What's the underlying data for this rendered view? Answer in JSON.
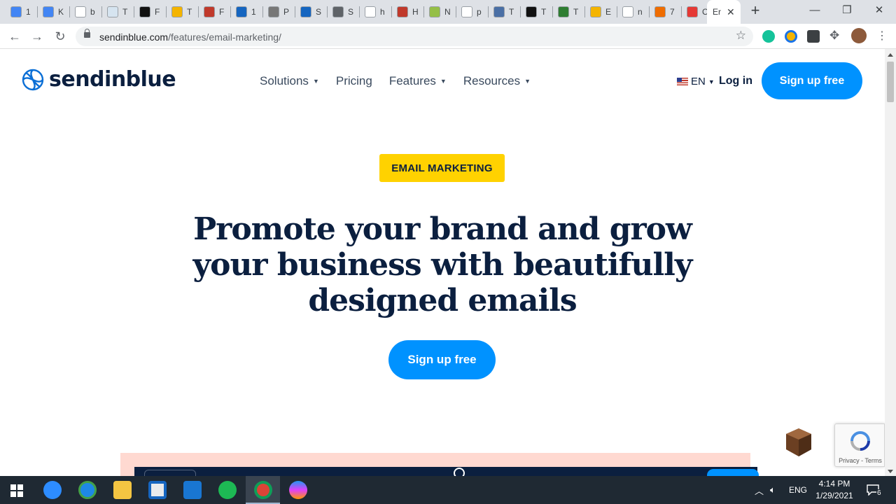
{
  "browser": {
    "tabs": [
      {
        "label": "1",
        "color": "#4285f4"
      },
      {
        "label": "K",
        "color": "#4285f4"
      },
      {
        "label": "b",
        "color": "#ffffff"
      },
      {
        "label": "T",
        "color": "#d6e4f0"
      },
      {
        "label": "F",
        "color": "#111111"
      },
      {
        "label": "T",
        "color": "#f4b400"
      },
      {
        "label": "F",
        "color": "#c0392b"
      },
      {
        "label": "1",
        "color": "#1565c0"
      },
      {
        "label": "P",
        "color": "#777777"
      },
      {
        "label": "S",
        "color": "#1565c0"
      },
      {
        "label": "S",
        "color": "#5f6368"
      },
      {
        "label": "h",
        "color": "#ffffff"
      },
      {
        "label": "H",
        "color": "#c0392b"
      },
      {
        "label": "N",
        "color": "#95bf47"
      },
      {
        "label": "p",
        "color": "#ffffff"
      },
      {
        "label": "T",
        "color": "#4a6fa5"
      },
      {
        "label": "T",
        "color": "#111111"
      },
      {
        "label": "T",
        "color": "#2e7d32"
      },
      {
        "label": "E",
        "color": "#f4b400"
      },
      {
        "label": "n",
        "color": "#ffffff"
      },
      {
        "label": "7",
        "color": "#ef6c00"
      },
      {
        "label": "C",
        "color": "#e53935"
      }
    ],
    "active_tab": {
      "label": "Er"
    },
    "url_host": "sendinblue.com",
    "url_path": "/features/email-marketing/"
  },
  "site": {
    "logo_text": "sendinblue",
    "nav": [
      {
        "label": "Solutions",
        "has_caret": true
      },
      {
        "label": "Pricing",
        "has_caret": false
      },
      {
        "label": "Features",
        "has_caret": true
      },
      {
        "label": "Resources",
        "has_caret": true
      }
    ],
    "language": "EN",
    "login_label": "Log in",
    "signup_label": "Sign up free",
    "accent_color": "#0092ff",
    "badge_color": "#ffd200"
  },
  "hero": {
    "badge": "EMAIL MARKETING",
    "headline": "Promote your brand and grow your business with beautifully designed emails",
    "cta_label": "Sign up free"
  },
  "recaptcha": {
    "text": "Privacy - Terms"
  },
  "taskbar": {
    "language": "ENG",
    "time": "4:14 PM",
    "date": "1/29/2021",
    "notifications": "6"
  }
}
